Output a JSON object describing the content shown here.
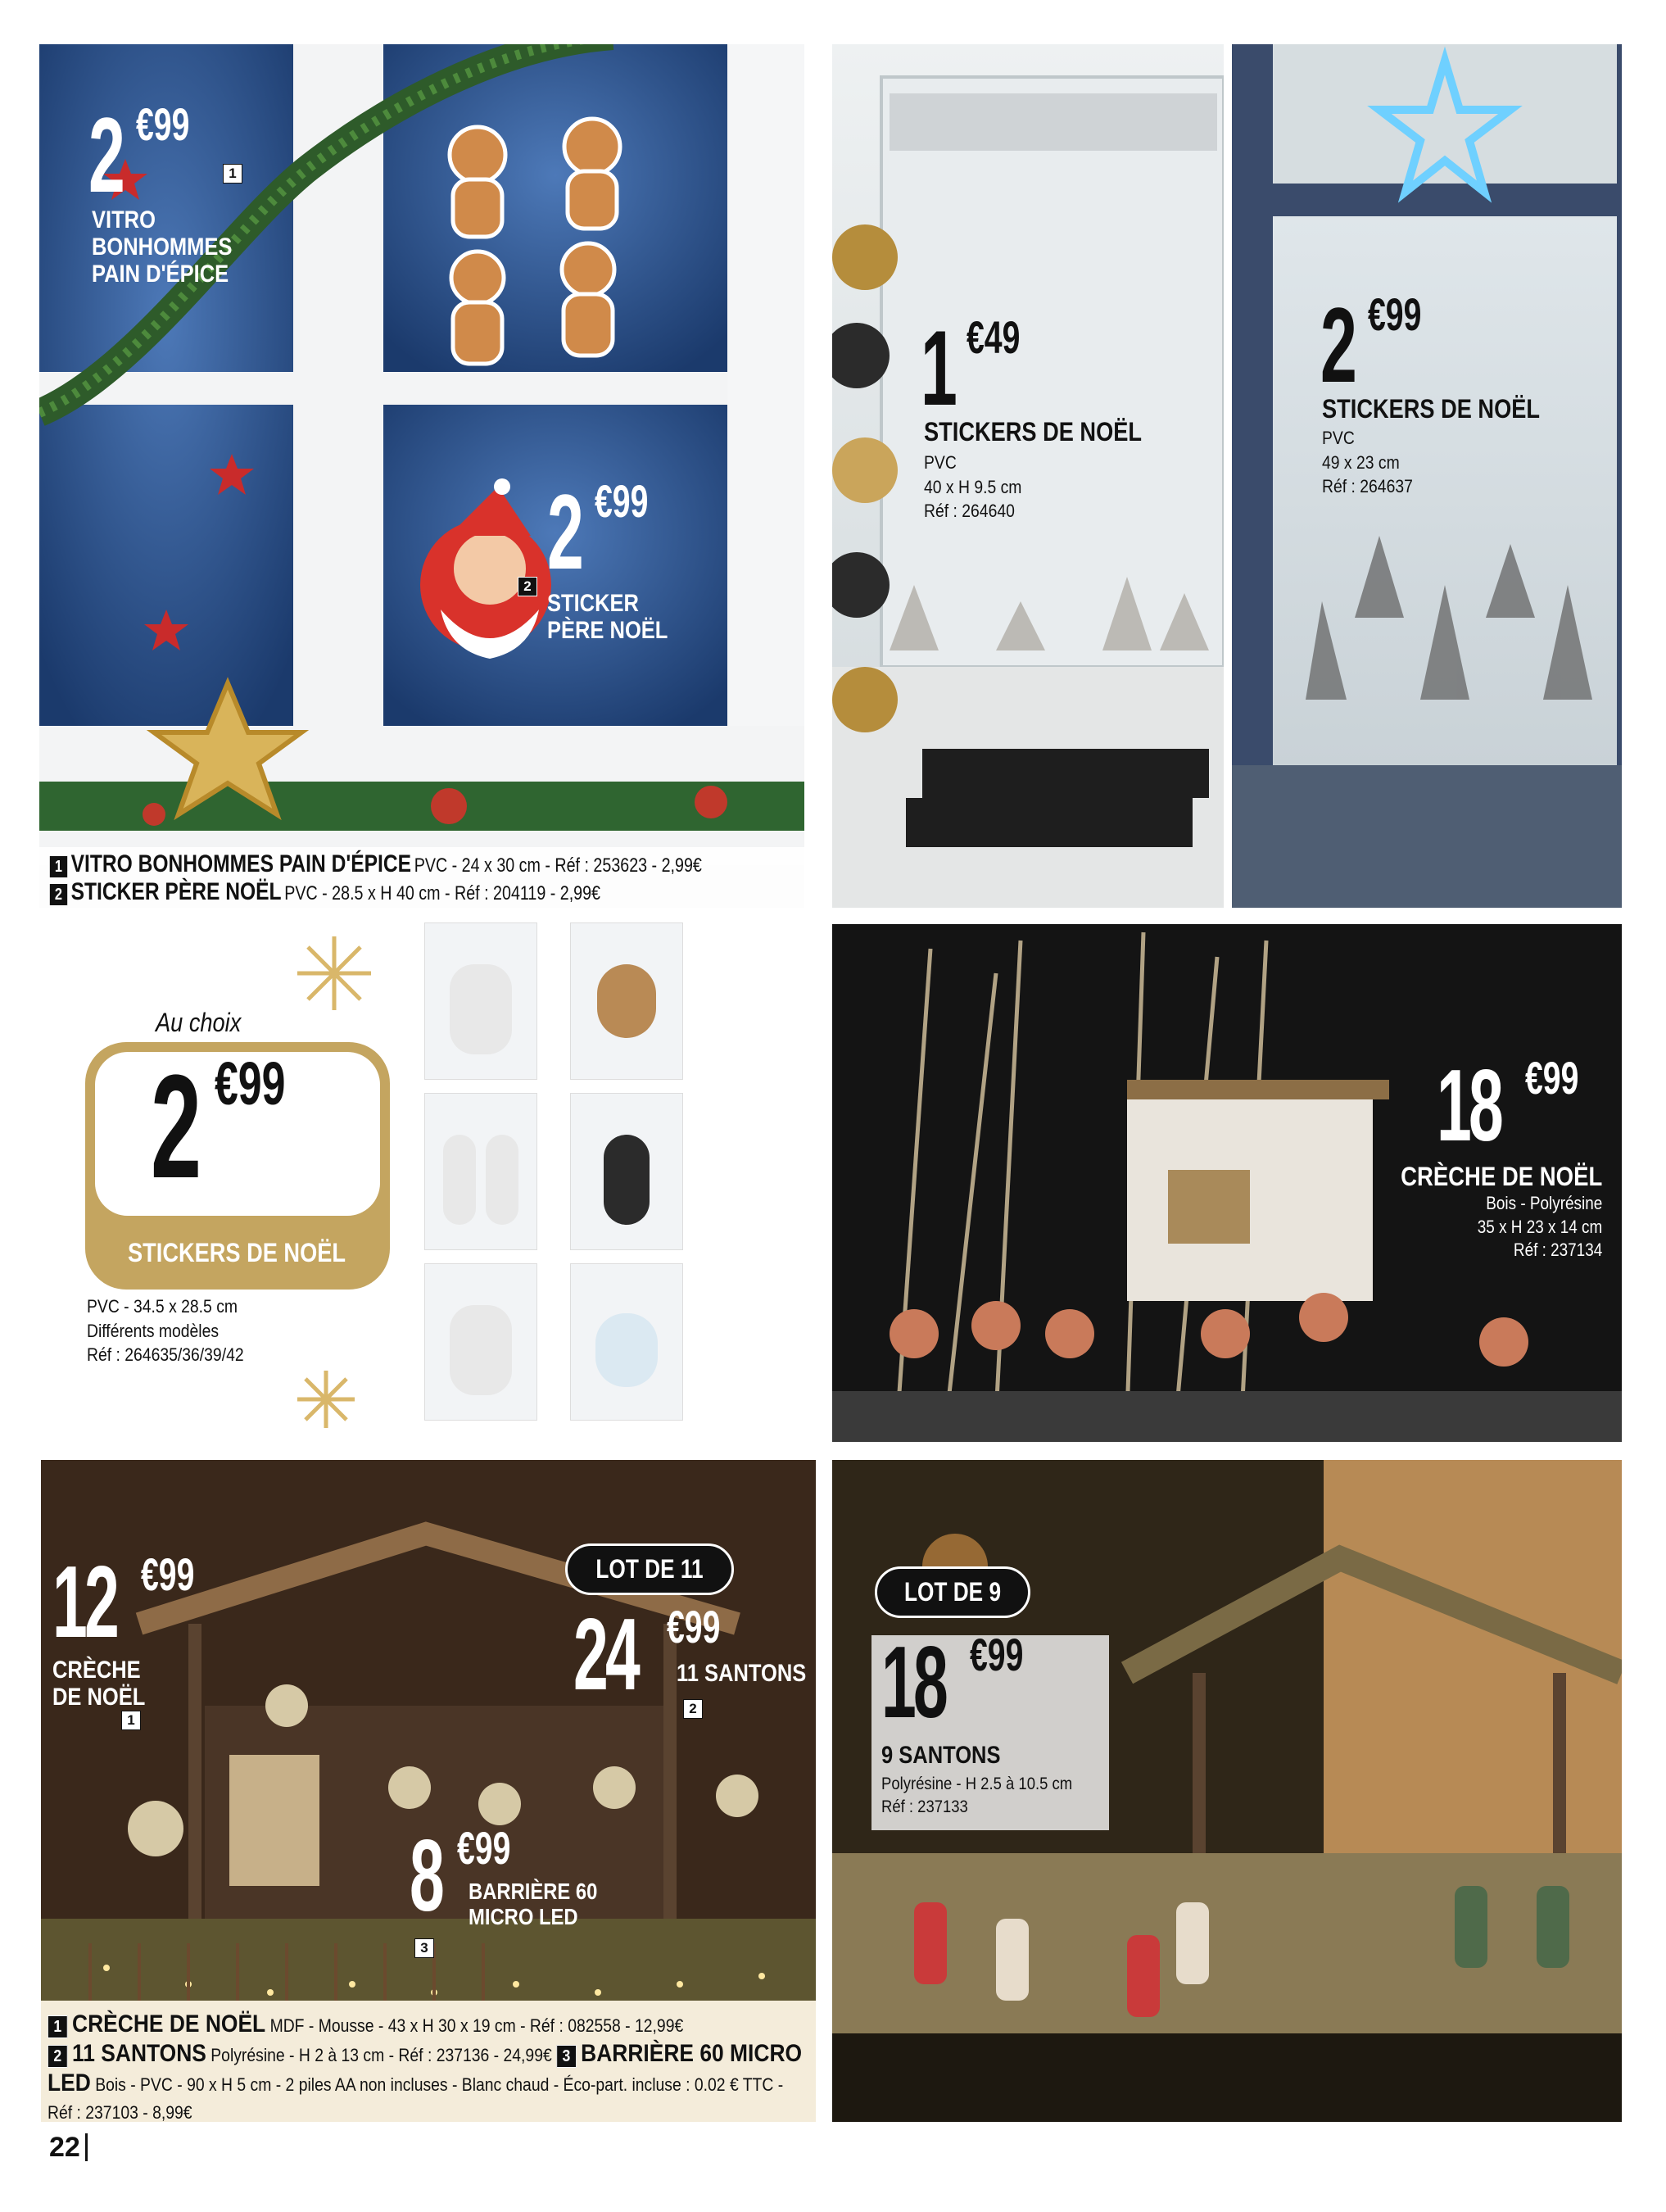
{
  "panel1": {
    "price_main": {
      "int": "2",
      "dec": "€99"
    },
    "product1_label": [
      "VITRO",
      "BONHOMMES",
      "PAIN D'ÉPICE"
    ],
    "badge1": "1",
    "price_second": {
      "int": "2",
      "dec": "€99"
    },
    "badge2": "2",
    "product2_label": [
      "STICKER",
      "PÈRE NOËL"
    ],
    "footer_line1_bold": "VITRO BONHOMMES PAIN D'ÉPICE",
    "footer_line1_rest": "PVC - 24 x 30 cm - Réf : 253623 - 2,99€",
    "footer_line2_bold": "STICKER PÈRE NOËL",
    "footer_line2_rest": "PVC - 28.5 x H 40 cm - Réf : 204119 - 2,99€"
  },
  "panel2": {
    "price": {
      "int": "1",
      "dec": "€49"
    },
    "title": "STICKERS DE NOËL",
    "details": [
      "PVC",
      "40 x H 9.5 cm",
      "Réf : 264640"
    ]
  },
  "panel3": {
    "price": {
      "int": "2",
      "dec": "€99"
    },
    "title": "STICKERS DE NOËL",
    "details": [
      "PVC",
      "49 x 23 cm",
      "Réf : 264637"
    ]
  },
  "panel4": {
    "au_choix": "Au choix",
    "price": {
      "int": "2",
      "dec": "€99"
    },
    "title": "STICKERS DE NOËL",
    "details": [
      "PVC - 34.5 x 28.5 cm",
      "Différents modèles",
      "Réf : 264635/36/39/42"
    ]
  },
  "panel5": {
    "price": {
      "int": "18",
      "dec": "€99"
    },
    "title": "CRÈCHE DE NOËL",
    "details": [
      "Bois - Polyrésine",
      "35 x H 23 x 14 cm",
      "Réf : 237134"
    ]
  },
  "panel6": {
    "price1": {
      "int": "12",
      "dec": "€99"
    },
    "label1": [
      "CRÈCHE",
      "DE NOËL"
    ],
    "badge1": "1",
    "lot": "LOT DE 11",
    "price2": {
      "int": "24",
      "dec": "€99"
    },
    "label2": "11 SANTONS",
    "badge2": "2",
    "price3": {
      "int": "8",
      "dec": "€99"
    },
    "label3": [
      "BARRIÈRE 60",
      "MICRO LED"
    ],
    "badge3": "3",
    "footer": [
      {
        "num": "1",
        "bold": "CRÈCHE DE NOËL",
        "rest": "MDF - Mousse - 43 x H 30 x 19 cm - Réf : 082558 - 12,99€"
      },
      {
        "num": "2",
        "bold": "11 SANTONS",
        "rest": "Polyrésine - H 2 à 13 cm - Réf : 237136 - 24,99€"
      },
      {
        "num": "3",
        "bold": "BARRIÈRE 60 MICRO LED",
        "rest": "Bois - PVC - 90 x H 5 cm - 2 piles AA non incluses - Blanc chaud - Éco-part. incluse : 0.02 € TTC - Réf : 237103 - 8,99€"
      }
    ]
  },
  "panel7": {
    "lot": "LOT DE 9",
    "price": {
      "int": "18",
      "dec": "€99"
    },
    "title": "9 SANTONS",
    "details": [
      "Polyrésine - H 2.5 à 10.5 cm",
      "Réf : 237133"
    ]
  },
  "page_number": "22"
}
